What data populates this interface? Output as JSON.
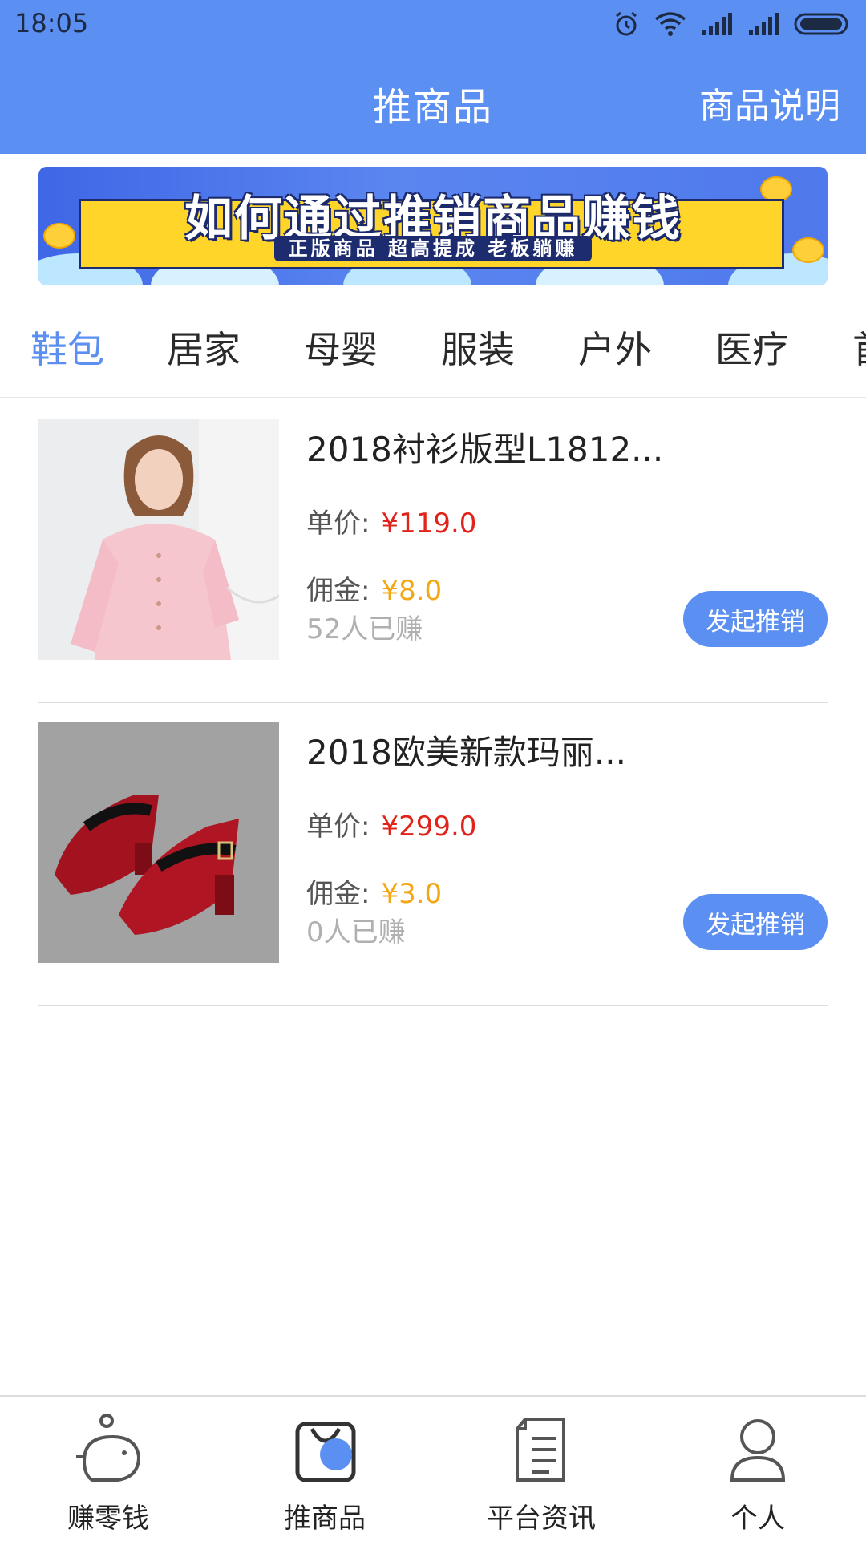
{
  "status_bar": {
    "time": "18:05"
  },
  "header": {
    "title": "推商品",
    "action": "商品说明"
  },
  "banner": {
    "title": "如何通过推销商品赚钱",
    "subtitle": "正版商品 超高提成 老板躺赚"
  },
  "tabs": [
    {
      "label": "鞋包",
      "active": true
    },
    {
      "label": "居家"
    },
    {
      "label": "母婴"
    },
    {
      "label": "服装"
    },
    {
      "label": "户外"
    },
    {
      "label": "医疗"
    },
    {
      "label": "首"
    }
  ],
  "labels": {
    "unit_price": "单价:",
    "commission": "佣金:",
    "promote": "发起推销"
  },
  "products": [
    {
      "title": "2018衬衫版型L1812...",
      "price": "¥119.0",
      "commission": "¥8.0",
      "earned": "52人已赚"
    },
    {
      "title": "2018欧美新款玛丽...",
      "price": "¥299.0",
      "commission": "¥3.0",
      "earned": "0人已赚"
    }
  ],
  "bottom_nav": [
    {
      "label": "赚零钱",
      "icon": "piggy-bank-icon"
    },
    {
      "label": "推商品",
      "icon": "shopping-bag-icon",
      "active": true
    },
    {
      "label": "平台资讯",
      "icon": "document-icon"
    },
    {
      "label": "个人",
      "icon": "person-icon"
    }
  ],
  "colors": {
    "primary": "#5b8ff2",
    "price": "#e0241b",
    "commission": "#f3a712",
    "muted": "#b0b0b0"
  }
}
